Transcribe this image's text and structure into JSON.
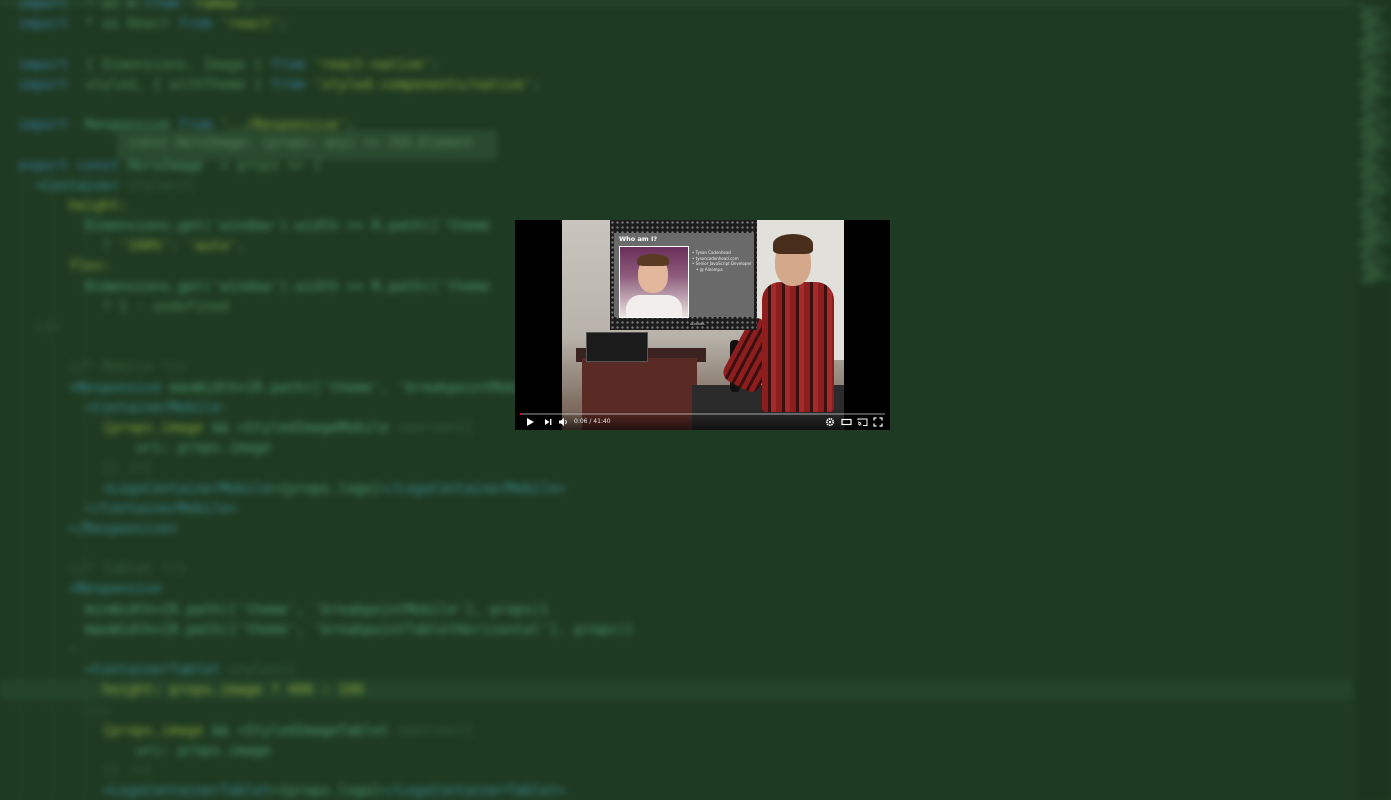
{
  "editor": {
    "hover_hint": "const HeroImage: (props: any) => JSX.Element",
    "lines": [
      [
        [
          "kw",
          "import"
        ],
        [
          "",
          "  * as "
        ],
        [
          "id",
          "R"
        ],
        [
          "kw",
          " from "
        ],
        [
          "str",
          "'ramda'"
        ],
        [
          "",
          ";"
        ]
      ],
      [
        [
          "kw",
          "import"
        ],
        [
          "",
          "  * as React "
        ],
        [
          "kw",
          "from "
        ],
        [
          "str",
          "'react'"
        ],
        [
          "",
          ";"
        ]
      ],
      [
        [
          "",
          ""
        ]
      ],
      [
        [
          "kw",
          "import"
        ],
        [
          "",
          "  { Dimensions, Image } "
        ],
        [
          "kw",
          "from "
        ],
        [
          "str",
          "'react-native'"
        ],
        [
          "",
          ";"
        ]
      ],
      [
        [
          "kw",
          "import"
        ],
        [
          "",
          "  styled, { withTheme } "
        ],
        [
          "kw",
          "from "
        ],
        [
          "str",
          "'styled-components/native'"
        ],
        [
          "",
          ";"
        ]
      ],
      [
        [
          "",
          ""
        ]
      ],
      [
        [
          "kw",
          "import"
        ],
        [
          "id",
          "  Responsive "
        ],
        [
          "kw",
          "from "
        ],
        [
          "str",
          "'../Responsive'"
        ],
        [
          "",
          ";"
        ]
      ],
      [
        [
          "",
          ""
        ]
      ],
      [
        [
          "kw",
          "export const "
        ],
        [
          "id",
          "HeroImage"
        ],
        [
          "",
          "  = props => {"
        ]
      ],
      [
        [
          "tag",
          "  <Container"
        ],
        [
          "",
          ""
        ],
        [
          "dim",
          " style={{"
        ]
      ],
      [
        [
          "str",
          "      height:"
        ]
      ],
      [
        [
          "",
          ""
        ],
        [
          "id",
          "        Dimensions.get('window').width >= R.path(['theme"
        ]
      ],
      [
        [
          "",
          "          ? "
        ],
        [
          "str",
          "'100%'"
        ],
        [
          "",
          ": "
        ],
        [
          "str",
          "'auto'"
        ],
        [
          "",
          ","
        ]
      ],
      [
        [
          "str",
          "      flex:"
        ]
      ],
      [
        [
          "",
          ""
        ],
        [
          "id",
          "        Dimensions.get('window').width >= R.path(['theme"
        ]
      ],
      [
        [
          "",
          "          ? 1 : undefined"
        ]
      ],
      [
        [
          "dim",
          "  }}>"
        ]
      ],
      [
        [
          "",
          ""
        ]
      ],
      [
        [
          "dim",
          "      {/* Mobile */}"
        ]
      ],
      [
        [
          "tag",
          "      <Responsive"
        ],
        [
          "id",
          " maxWidth={R.path(['theme', 'breakpointMobi"
        ]
      ],
      [
        [
          "tag",
          "        <ContainerMobile"
        ],
        [
          "dim",
          ">"
        ]
      ],
      [
        [
          "str",
          "          {props.image "
        ],
        [
          "id",
          "&& <StyledImageMobile "
        ],
        [
          "dim",
          "source={{"
        ]
      ],
      [
        [
          "id",
          "              uri: props.image"
        ]
      ],
      [
        [
          "dim",
          "          }} />}"
        ]
      ],
      [
        [
          "tag",
          "          <LogoContainerMobile"
        ],
        [
          "id",
          ">{props.logo}"
        ],
        [
          "tag",
          "</LogoContainerMobile>"
        ]
      ],
      [
        [
          "tag",
          "        </ContainerMobile>"
        ]
      ],
      [
        [
          "tag",
          "      </Responsive>"
        ]
      ],
      [
        [
          "",
          ""
        ]
      ],
      [
        [
          "dim",
          "      {/* Tablet */}"
        ]
      ],
      [
        [
          "tag",
          "      <Responsive"
        ]
      ],
      [
        [
          "id",
          "        minWidth={R.path(['theme', 'breakpointMobile'], props)}"
        ]
      ],
      [
        [
          "id",
          "        maxWidth={R.path(['theme', 'breakpointTabletHorizontal'], props)}"
        ]
      ],
      [
        [
          "dim",
          "      >"
        ]
      ],
      [
        [
          "tag",
          "        <ContainerTablet"
        ],
        [
          "dim",
          " style={{"
        ]
      ],
      [
        [
          "str",
          "          height: props.image ? 400 : 100"
        ]
      ],
      [
        [
          "dim",
          "        }}>"
        ]
      ],
      [
        [
          "str",
          "          {props.image "
        ],
        [
          "id",
          "&& <StyledImageTablet "
        ],
        [
          "dim",
          "source={{"
        ]
      ],
      [
        [
          "id",
          "              uri: props.image"
        ]
      ],
      [
        [
          "dim",
          "          }} />}"
        ]
      ],
      [
        [
          "tag",
          "          <LogoContainerTablet"
        ],
        [
          "id",
          ">{props.logo}"
        ],
        [
          "tag",
          "</LogoContainerTablet>"
        ]
      ]
    ]
  },
  "video": {
    "slide": {
      "title": "Who am I?",
      "bullets": [
        "Tyson Cadenhead",
        "tysoncadenhead.com",
        "Senior JavaScript Developer",
        "@ Aloompa"
      ],
      "footer": "ALOOMPA"
    },
    "controls": {
      "time": "0:06 / 41:40",
      "progress": 0.0024
    }
  }
}
